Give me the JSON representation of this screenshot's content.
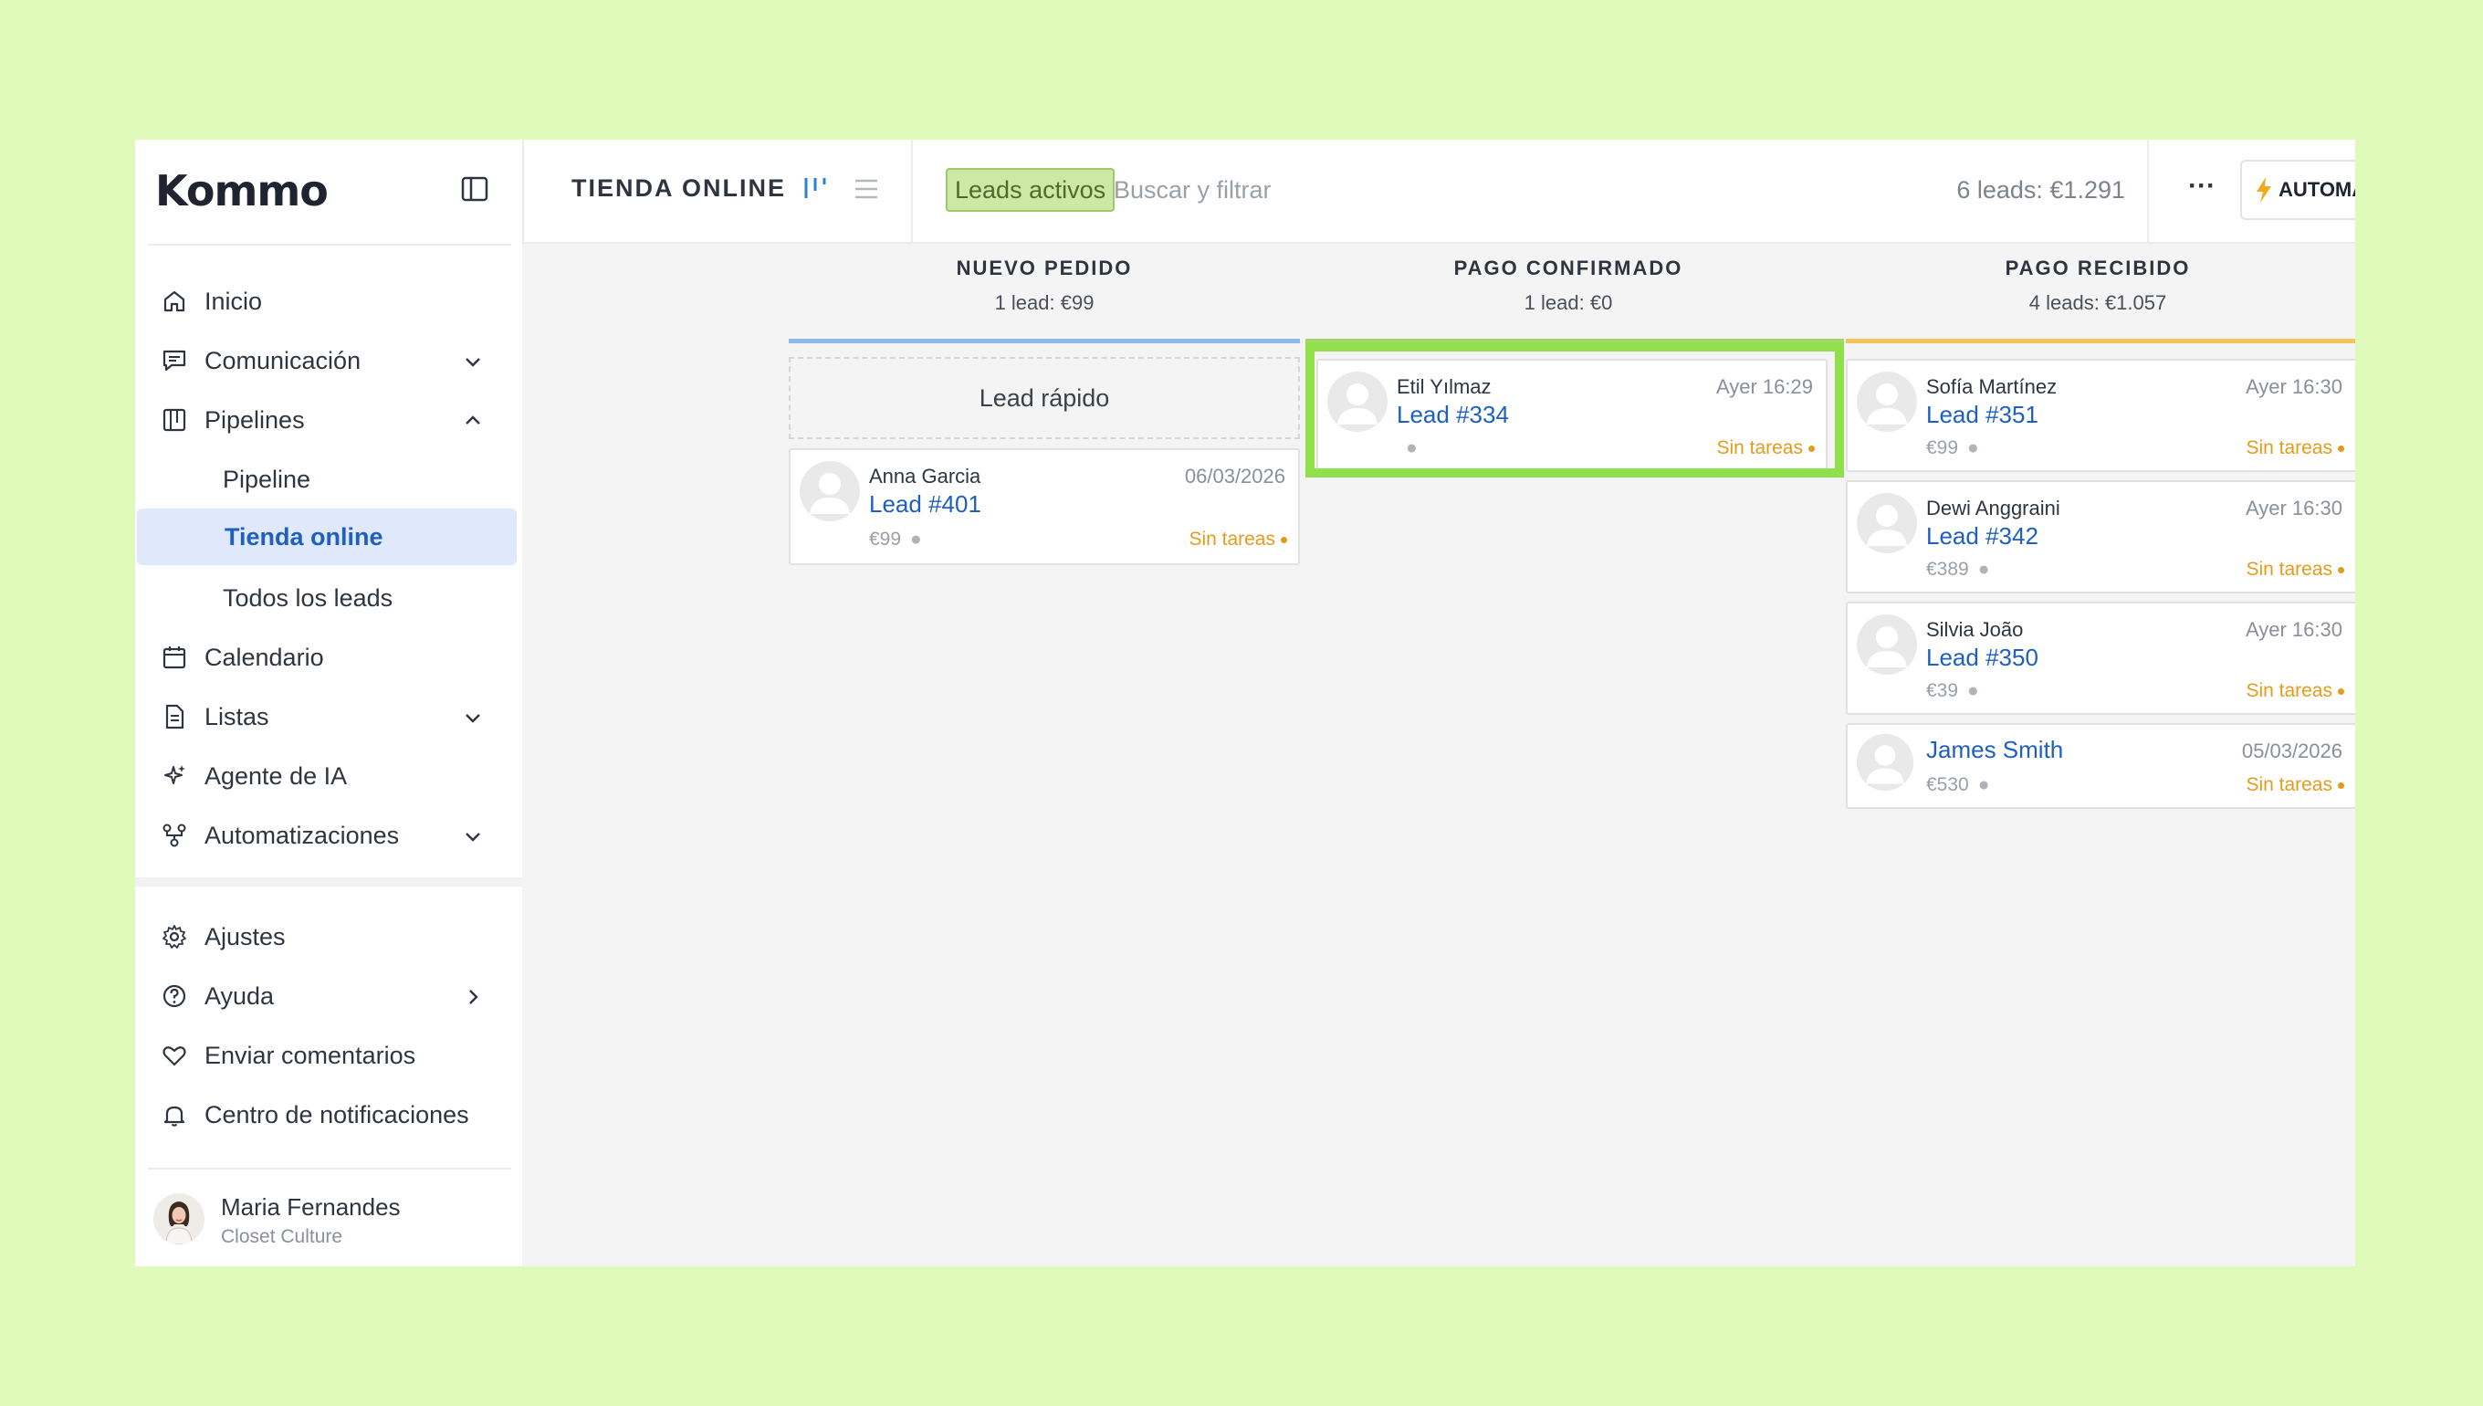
{
  "brand": {
    "name": "Kommo"
  },
  "sidebar": {
    "items": [
      {
        "label": "Inicio",
        "icon": "home-icon"
      },
      {
        "label": "Comunicación",
        "icon": "chat-icon",
        "chevron": "down"
      },
      {
        "label": "Pipelines",
        "icon": "pipeline-icon",
        "chevron": "up"
      },
      {
        "label": "Pipeline"
      },
      {
        "label": "Tienda online",
        "active": true
      },
      {
        "label": "Todos los leads"
      },
      {
        "label": "Calendario",
        "icon": "calendar-icon"
      },
      {
        "label": "Listas",
        "icon": "document-icon",
        "chevron": "down"
      },
      {
        "label": "Agente de IA",
        "icon": "sparkle-icon"
      },
      {
        "label": "Automatizaciones",
        "icon": "flow-icon",
        "chevron": "down"
      }
    ],
    "bottom_items": [
      {
        "label": "Ajustes",
        "icon": "gear-icon"
      },
      {
        "label": "Ayuda",
        "icon": "help-icon",
        "chevron": "right"
      },
      {
        "label": "Enviar comentarios",
        "icon": "heart-icon"
      },
      {
        "label": "Centro de notificaciones",
        "icon": "bell-icon"
      }
    ],
    "user": {
      "name": "Maria Fernandes",
      "org": "Closet Culture"
    }
  },
  "header": {
    "title": "TIENDA ONLINE",
    "filter_chip": "Leads activos",
    "search_placeholder": "Buscar y filtrar",
    "summary": "6 leads: €1.291",
    "more": "···",
    "automate_label": "AUTOMA"
  },
  "columns": [
    {
      "title": "NUEVO PEDIDO",
      "subtitle": "1 lead: €99",
      "color": "#8fb7ea"
    },
    {
      "title": "PAGO CONFIRMADO",
      "subtitle": "1 lead: €0",
      "color": "#a4d66b"
    },
    {
      "title": "PAGO RECIBIDO",
      "subtitle": "4 leads: €1.057",
      "color": "#f6c457"
    }
  ],
  "quick_lead": "Lead rápido",
  "cards": {
    "anna": {
      "contact": "Anna Garcia",
      "lead": "Lead #401",
      "time": "06/03/2026",
      "price": "€99",
      "tasks": "Sin tareas"
    },
    "etil": {
      "contact": "Etil Yılmaz",
      "lead": "Lead #334",
      "time": "Ayer 16:29",
      "price": "",
      "tasks": "Sin tareas"
    },
    "sofia": {
      "contact": "Sofía Martínez",
      "lead": "Lead #351",
      "time": "Ayer 16:30",
      "price": "€99",
      "tasks": "Sin tareas"
    },
    "dewi": {
      "contact": "Dewi Anggraini",
      "lead": "Lead #342",
      "time": "Ayer 16:30",
      "price": "€389",
      "tasks": "Sin tareas"
    },
    "silvia": {
      "contact": "Silvia João",
      "lead": "Lead #350",
      "time": "Ayer 16:30",
      "price": "€39",
      "tasks": "Sin tareas"
    },
    "james": {
      "lead": "James Smith",
      "time": "05/03/2026",
      "price": "€530",
      "tasks": "Sin tareas"
    }
  },
  "colors": {
    "accent": "#1f5fbf",
    "highlight": "#8fe04a",
    "tasks": "#e49b1c",
    "background": "#e0fabb"
  }
}
